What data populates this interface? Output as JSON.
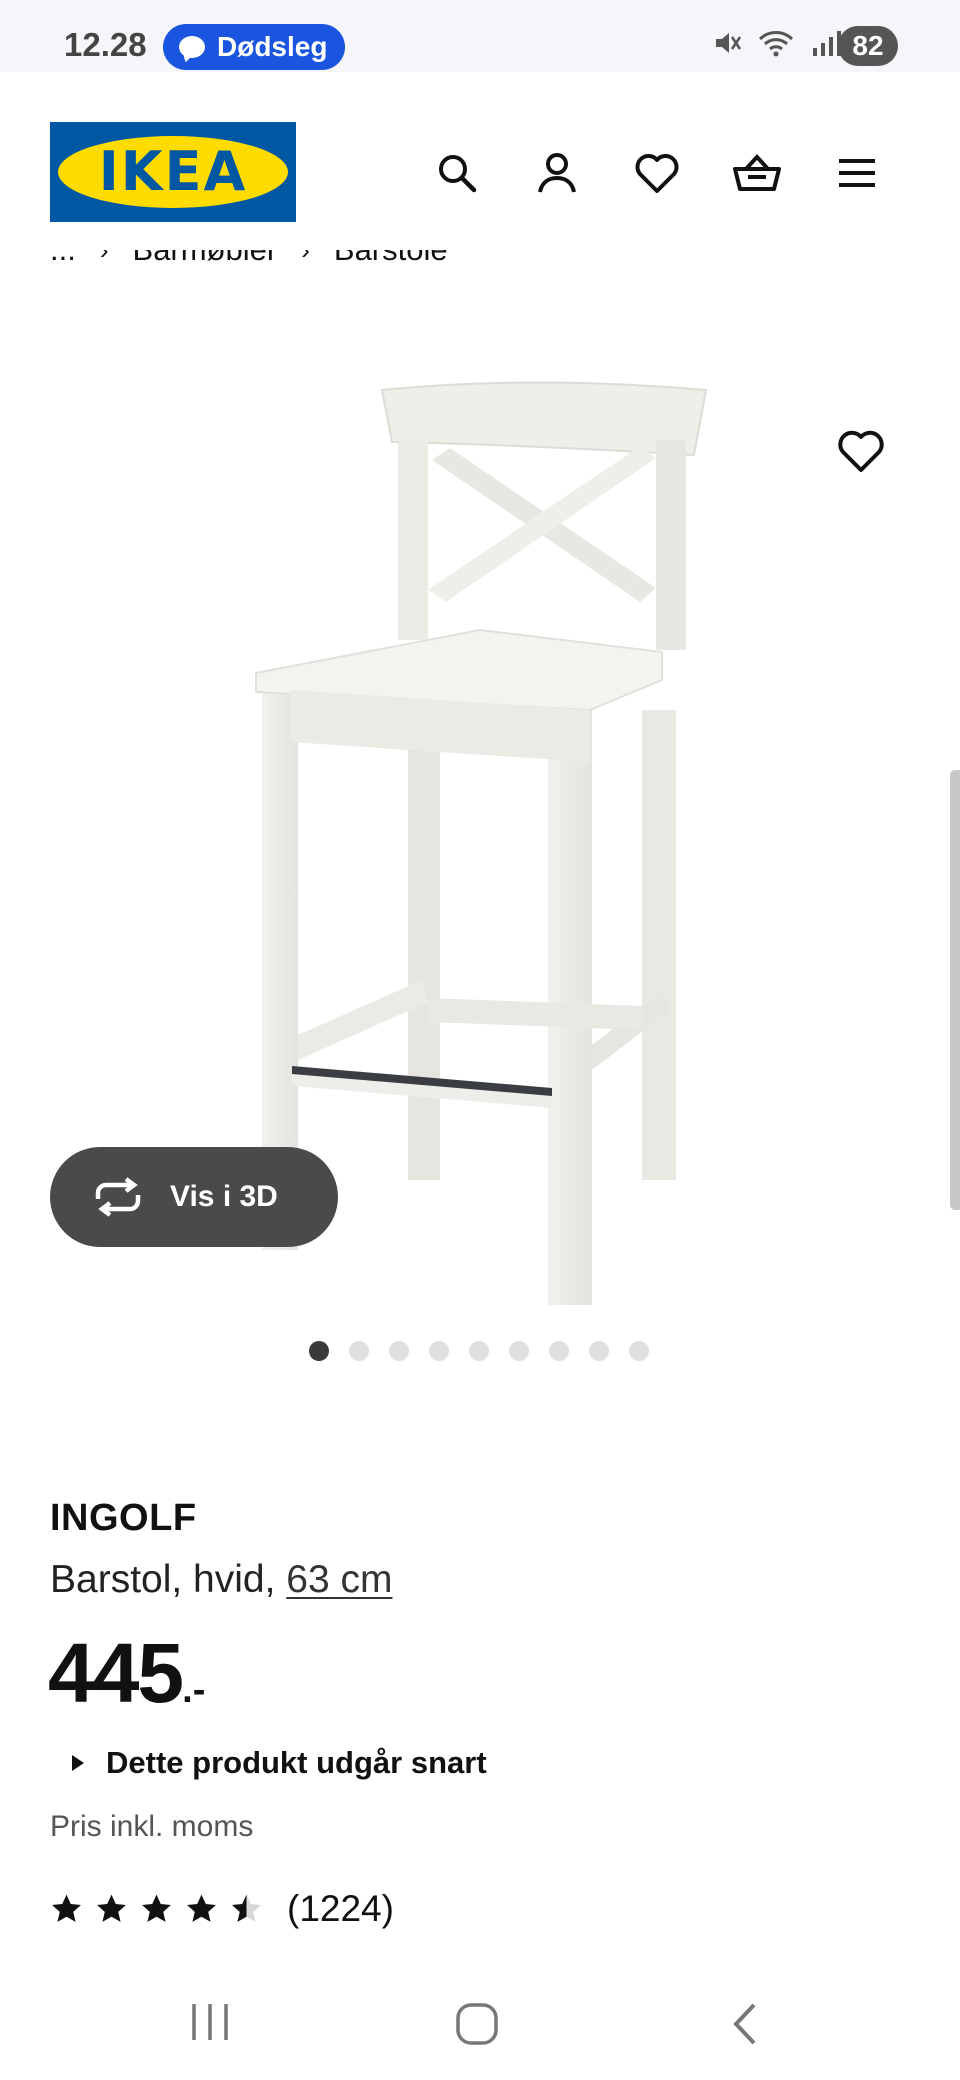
{
  "status_bar": {
    "time": "12.28",
    "notification_label": "Dødsleg",
    "battery": "82"
  },
  "header": {
    "logo_text": "IKEA",
    "icons": [
      "search-icon",
      "profile-icon",
      "heart-icon",
      "basket-icon",
      "menu-icon"
    ]
  },
  "breadcrumb": [
    "...",
    "Barmøbler",
    "Barstole"
  ],
  "gallery": {
    "vis_3d_label": "Vis i 3D",
    "image_count": 9,
    "active_index": 0
  },
  "product": {
    "name": "INGOLF",
    "description": "Barstol, hvid, ",
    "size_link": "63 cm",
    "price_main": "445",
    "price_suffix": ".-",
    "discontinued_label": "Dette produkt udgår snart",
    "vat_note": "Pris inkl. moms",
    "rating": 4.5,
    "rating_max": 5,
    "review_count": "(1224)"
  },
  "colors": {
    "ikea_blue": "#0058a3",
    "ikea_yellow": "#ffdb00",
    "pill_blue": "#1a55e0",
    "button_dark": "#4a4a4a"
  }
}
